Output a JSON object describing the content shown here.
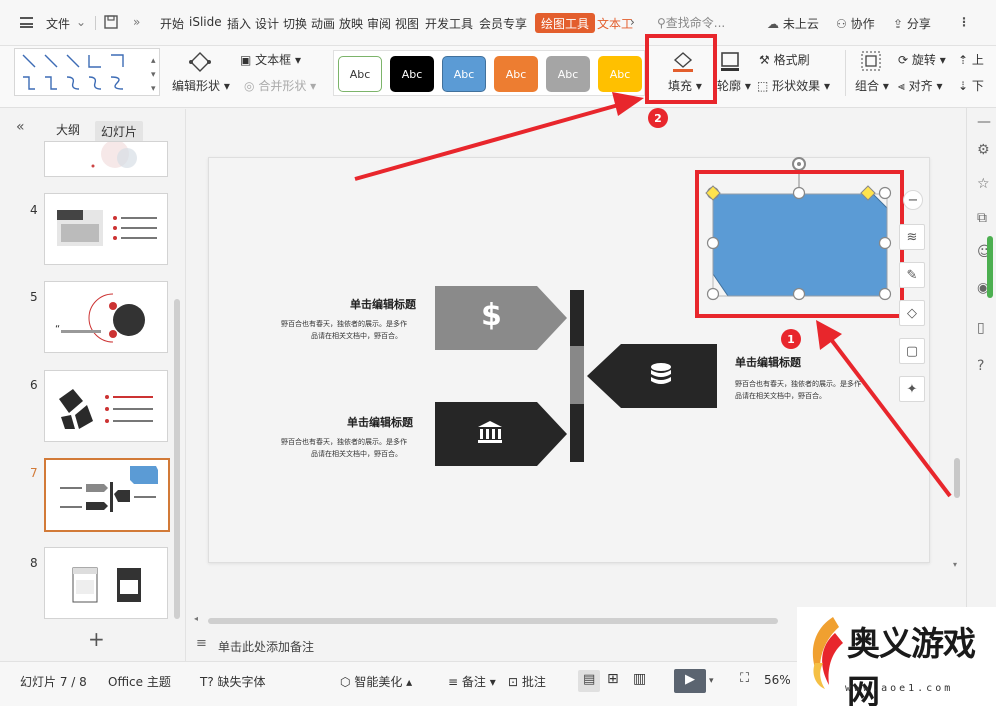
{
  "menubar": {
    "file": "文件",
    "tabs": [
      "开始",
      "iSlide",
      "插入",
      "设计",
      "切换",
      "动画",
      "放映",
      "审阅",
      "视图",
      "开发工具",
      "会员专享"
    ],
    "active_tab": "绘图工具",
    "next_tab": "文本工",
    "search": "查找命令...",
    "cloud": "未上云",
    "collab": "协作",
    "share": "分享"
  },
  "ribbon": {
    "edit_shape": "编辑形状",
    "text_box": "文本框",
    "merge_shape": "合并形状",
    "style_buttons": [
      {
        "label": "Abc",
        "bg": "#ffffff",
        "fg": "#333333",
        "border": "#7cb46a"
      },
      {
        "label": "Abc",
        "bg": "#000000",
        "fg": "#ffffff",
        "border": "#000000"
      },
      {
        "label": "Abc",
        "bg": "#5b9bd5",
        "fg": "#ffffff",
        "border": "#41719c"
      },
      {
        "label": "Abc",
        "bg": "#ed7d31",
        "fg": "#ffffff",
        "border": "#ed7d31"
      },
      {
        "label": "Abc",
        "bg": "#a5a5a5",
        "fg": "#ffffff",
        "border": "#a5a5a5"
      },
      {
        "label": "Abc",
        "bg": "#ffc000",
        "fg": "#ffffff",
        "border": "#ffc000"
      }
    ],
    "fill": "填充",
    "outline": "轮廓",
    "format_painter": "格式刷",
    "shape_effect": "形状效果",
    "group": "组合",
    "rotate": "旋转",
    "align": "对齐",
    "up": "上",
    "down": "下"
  },
  "annotations": [
    "1",
    "2"
  ],
  "left_panel": {
    "tab_outline": "大纲",
    "tab_slides": "幻灯片",
    "slide_numbers": [
      "4",
      "5",
      "6",
      "7",
      "8"
    ],
    "selected": "7",
    "add": "+"
  },
  "slide": {
    "title_left_top": "单击编辑标题",
    "body_left_top": [
      "野百合也有春天，独依者的展示。是多作",
      "品请在相关文档中，野百合。"
    ],
    "title_left_bottom": "单击编辑标题",
    "body_left_bottom": [
      "野百合也有春天，独依者的展示。是多作",
      "品请在相关文档中，野百合。"
    ],
    "title_right": "单击编辑标题",
    "body_right": [
      "野百合也有春天，独依者的展示。是多作",
      "品请在相关文档中，野百合。"
    ],
    "shape_fill": "#5b9bd5"
  },
  "notes": "单击此处添加备注",
  "status": {
    "slide_count": "幻灯片 7 / 8",
    "theme": "Office 主题",
    "missing_font": "缺失字体",
    "smart": "智能美化",
    "notes": "备注",
    "comment": "批注",
    "zoom": "56%"
  },
  "watermark": {
    "title": "奥义游戏网",
    "url": "www.aoe1.com"
  }
}
